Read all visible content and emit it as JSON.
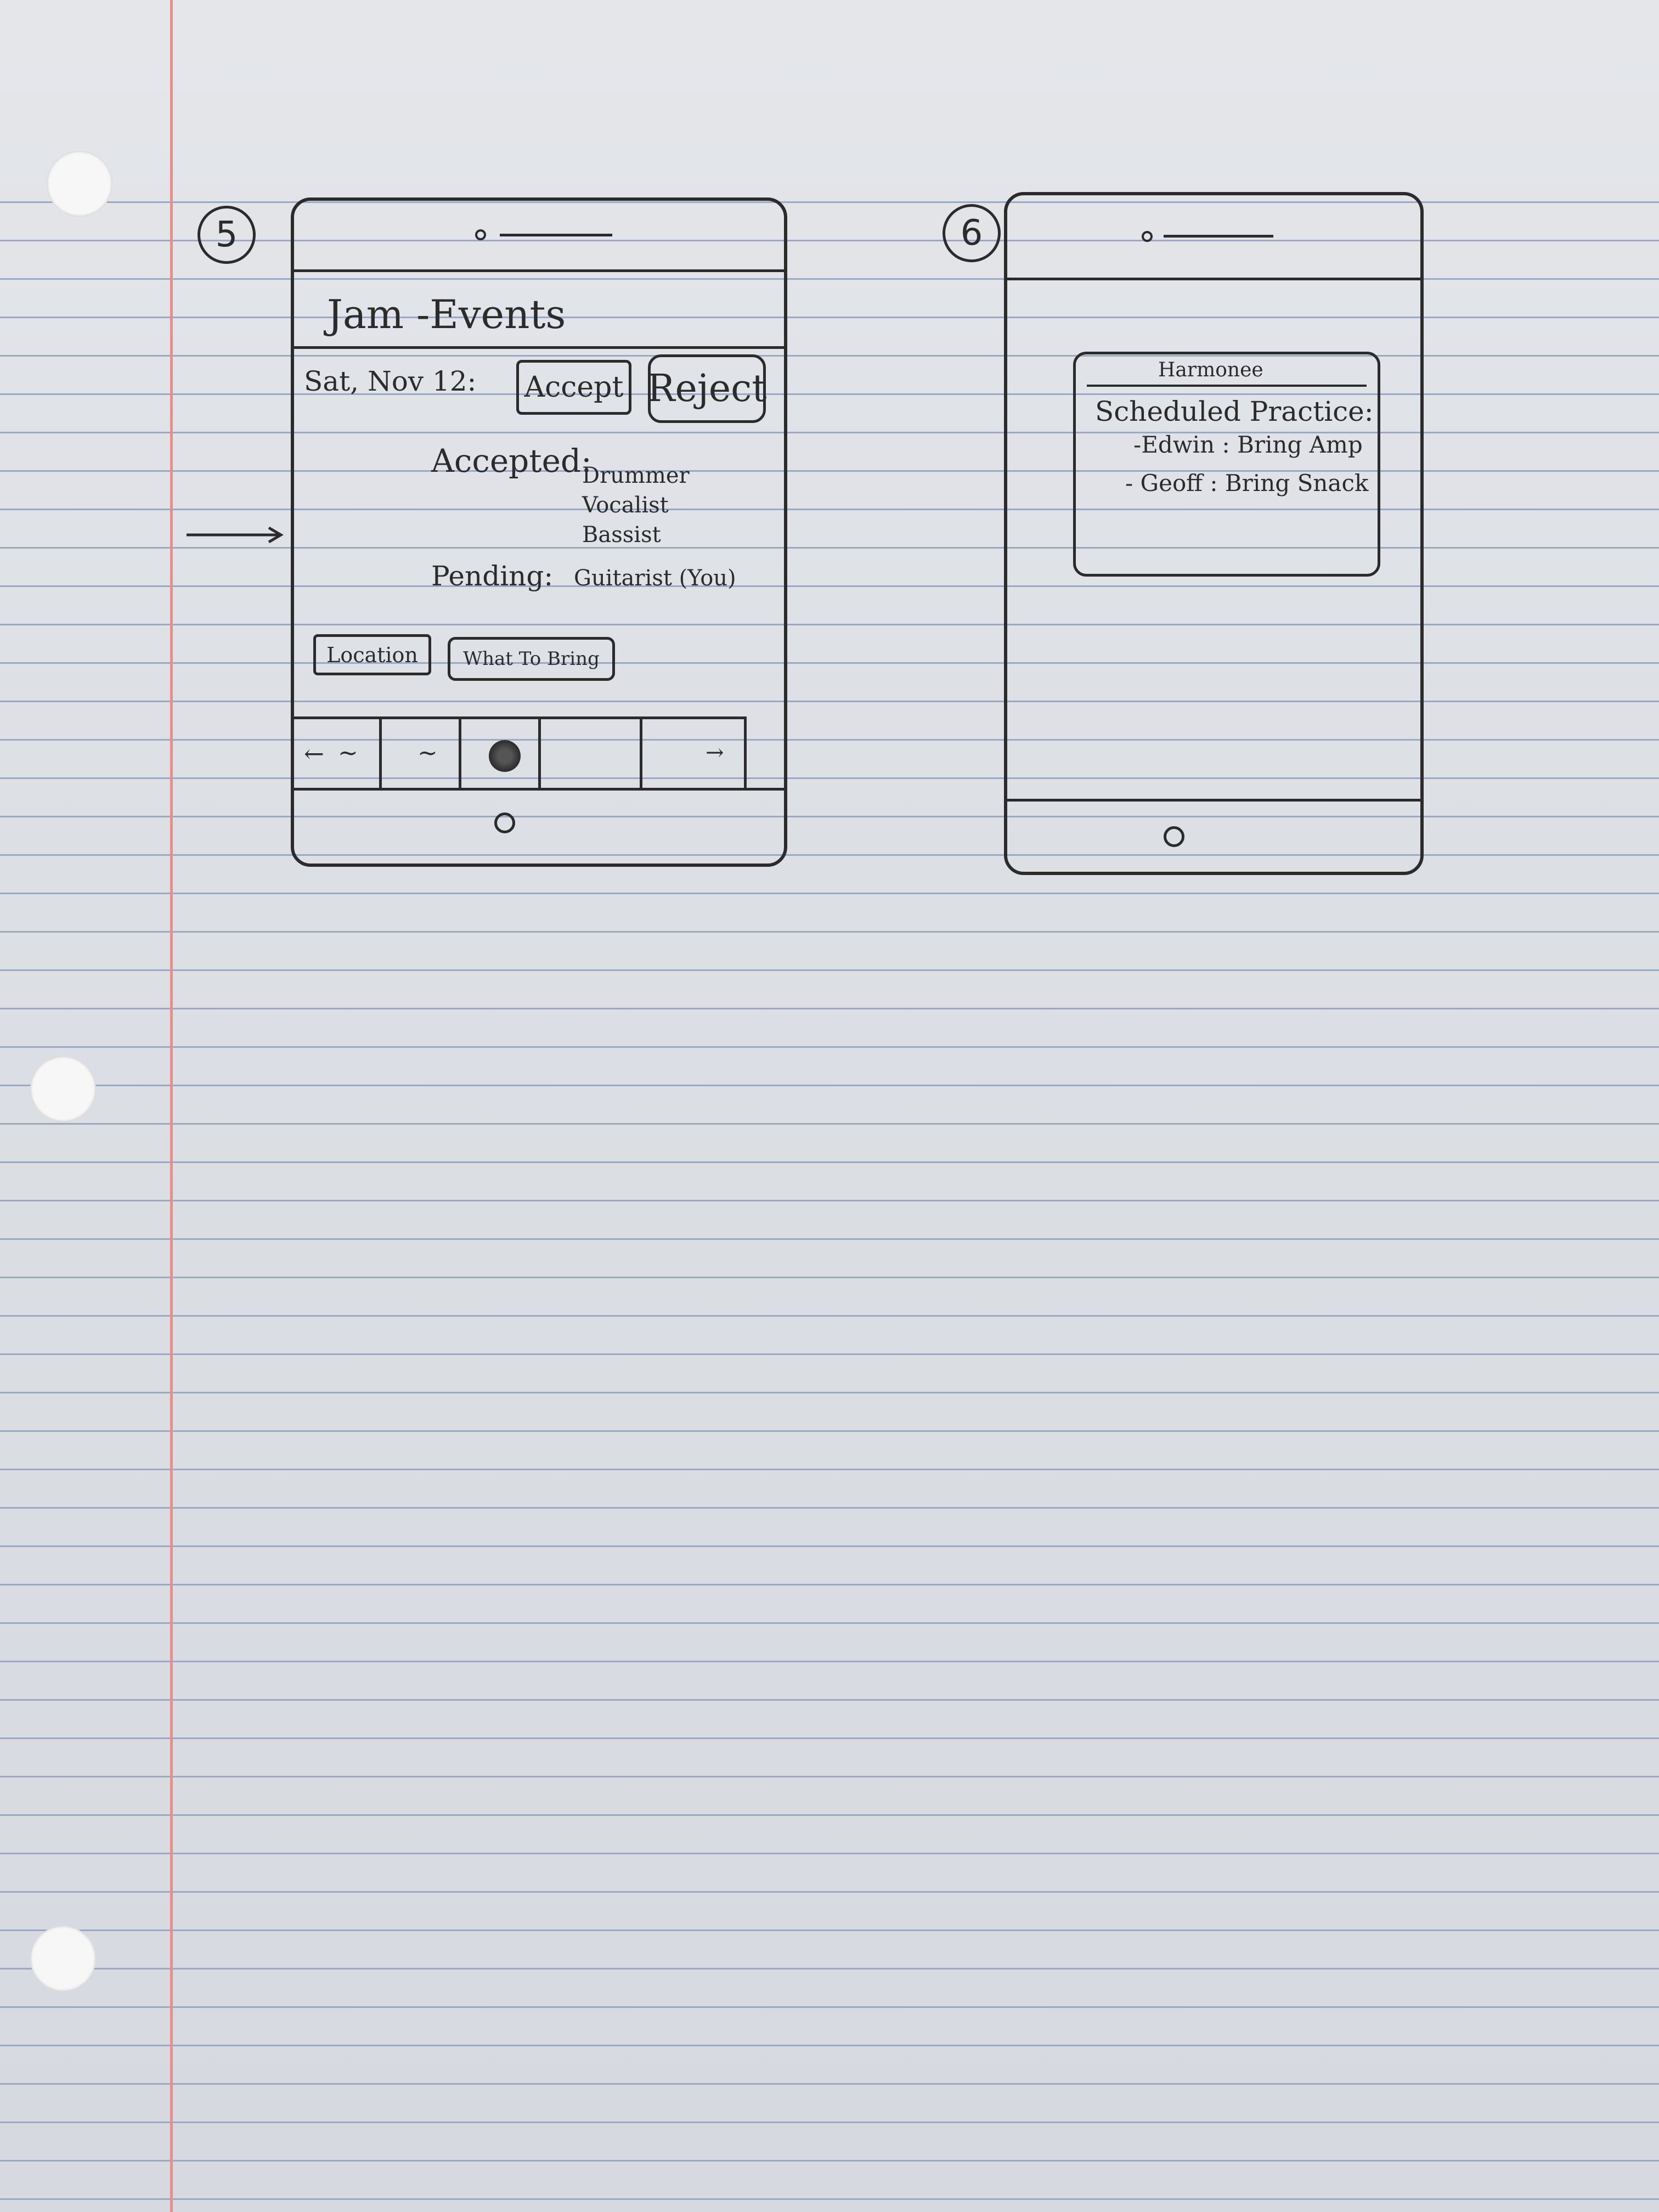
{
  "screens": [
    {
      "number": "5",
      "title": "Jam -Events",
      "event_date": "Sat, Nov 12:",
      "accept_label": "Accept",
      "reject_label": "Reject",
      "accepted_label": "Accepted:",
      "accepted_members": [
        "Drummer",
        "Vocalist",
        "Bassist"
      ],
      "pending_label": "Pending:",
      "pending_member": "Guitarist (You)",
      "location_label": "Location",
      "what_to_bring_label": "What To Bring",
      "nav_left": "←",
      "nav_right": "→",
      "nav_wave_1": "~",
      "nav_wave_2": "~"
    },
    {
      "number": "6",
      "popup_title": "Harmonee",
      "scheduled_label": "Scheduled Practice:",
      "items": [
        "-Edwin : Bring Amp",
        "- Geoff : Bring Snack"
      ]
    }
  ]
}
